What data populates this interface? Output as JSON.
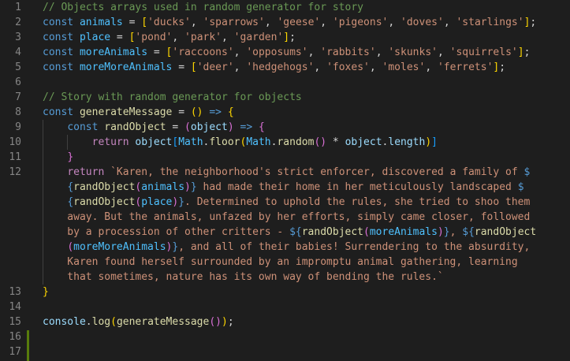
{
  "editor": {
    "line_numbers": [
      "1",
      "2",
      "3",
      "4",
      "5",
      "6",
      "7",
      "8",
      "9",
      "10",
      "11",
      "12",
      "13",
      "14",
      "15",
      "16",
      "17"
    ],
    "lines": [
      [
        {
          "t": "// Objects arrays used in random generator for story",
          "c": "com"
        }
      ],
      [
        {
          "t": "const ",
          "c": "kw"
        },
        {
          "t": "animals",
          "c": "cst"
        },
        {
          "t": " = ",
          "c": "op"
        },
        {
          "t": "[",
          "c": "b1"
        },
        {
          "t": "'ducks'",
          "c": "str"
        },
        {
          "t": ", ",
          "c": "op"
        },
        {
          "t": "'sparrows'",
          "c": "str"
        },
        {
          "t": ", ",
          "c": "op"
        },
        {
          "t": "'geese'",
          "c": "str"
        },
        {
          "t": ", ",
          "c": "op"
        },
        {
          "t": "'pigeons'",
          "c": "str"
        },
        {
          "t": ", ",
          "c": "op"
        },
        {
          "t": "'doves'",
          "c": "str"
        },
        {
          "t": ", ",
          "c": "op"
        },
        {
          "t": "'starlings'",
          "c": "str"
        },
        {
          "t": "]",
          "c": "b1"
        },
        {
          "t": ";",
          "c": "op"
        }
      ],
      [
        {
          "t": "const ",
          "c": "kw"
        },
        {
          "t": "place",
          "c": "cst"
        },
        {
          "t": " = ",
          "c": "op"
        },
        {
          "t": "[",
          "c": "b1"
        },
        {
          "t": "'pond'",
          "c": "str"
        },
        {
          "t": ", ",
          "c": "op"
        },
        {
          "t": "'park'",
          "c": "str"
        },
        {
          "t": ", ",
          "c": "op"
        },
        {
          "t": "'garden'",
          "c": "str"
        },
        {
          "t": "]",
          "c": "b1"
        },
        {
          "t": ";",
          "c": "op"
        }
      ],
      [
        {
          "t": "const ",
          "c": "kw"
        },
        {
          "t": "moreAnimals",
          "c": "cst"
        },
        {
          "t": " = ",
          "c": "op"
        },
        {
          "t": "[",
          "c": "b1"
        },
        {
          "t": "'raccoons'",
          "c": "str"
        },
        {
          "t": ", ",
          "c": "op"
        },
        {
          "t": "'opposums'",
          "c": "str"
        },
        {
          "t": ", ",
          "c": "op"
        },
        {
          "t": "'rabbits'",
          "c": "str"
        },
        {
          "t": ", ",
          "c": "op"
        },
        {
          "t": "'skunks'",
          "c": "str"
        },
        {
          "t": ", ",
          "c": "op"
        },
        {
          "t": "'squirrels'",
          "c": "str"
        },
        {
          "t": "]",
          "c": "b1"
        },
        {
          "t": ";",
          "c": "op"
        }
      ],
      [
        {
          "t": "const ",
          "c": "kw"
        },
        {
          "t": "moreMoreAnimals",
          "c": "cst"
        },
        {
          "t": " = ",
          "c": "op"
        },
        {
          "t": "[",
          "c": "b1"
        },
        {
          "t": "'deer'",
          "c": "str"
        },
        {
          "t": ", ",
          "c": "op"
        },
        {
          "t": "'hedgehogs'",
          "c": "str"
        },
        {
          "t": ", ",
          "c": "op"
        },
        {
          "t": "'foxes'",
          "c": "str"
        },
        {
          "t": ", ",
          "c": "op"
        },
        {
          "t": "'moles'",
          "c": "str"
        },
        {
          "t": ", ",
          "c": "op"
        },
        {
          "t": "'ferrets'",
          "c": "str"
        },
        {
          "t": "]",
          "c": "b1"
        },
        {
          "t": ";",
          "c": "op"
        }
      ],
      [],
      [
        {
          "t": "// Story with random generator for objects",
          "c": "com"
        }
      ],
      [
        {
          "t": "const ",
          "c": "kw"
        },
        {
          "t": "generateMessage",
          "c": "fn"
        },
        {
          "t": " = ",
          "c": "op"
        },
        {
          "t": "()",
          "c": "b1"
        },
        {
          "t": " ",
          "c": "op"
        },
        {
          "t": "=>",
          "c": "kw"
        },
        {
          "t": " ",
          "c": "op"
        },
        {
          "t": "{",
          "c": "b1"
        }
      ],
      [
        {
          "t": "    ",
          "c": "op"
        },
        {
          "t": "const ",
          "c": "kw"
        },
        {
          "t": "randObject",
          "c": "fn"
        },
        {
          "t": " = ",
          "c": "op"
        },
        {
          "t": "(",
          "c": "b2"
        },
        {
          "t": "object",
          "c": "var"
        },
        {
          "t": ")",
          "c": "b2"
        },
        {
          "t": " ",
          "c": "op"
        },
        {
          "t": "=>",
          "c": "kw"
        },
        {
          "t": " ",
          "c": "op"
        },
        {
          "t": "{",
          "c": "b2"
        }
      ],
      [
        {
          "t": "        ",
          "c": "op"
        },
        {
          "t": "return ",
          "c": "ctl"
        },
        {
          "t": "object",
          "c": "var"
        },
        {
          "t": "[",
          "c": "b3"
        },
        {
          "t": "Math",
          "c": "cst"
        },
        {
          "t": ".",
          "c": "op"
        },
        {
          "t": "floor",
          "c": "fn"
        },
        {
          "t": "(",
          "c": "b1"
        },
        {
          "t": "Math",
          "c": "cst"
        },
        {
          "t": ".",
          "c": "op"
        },
        {
          "t": "random",
          "c": "fn"
        },
        {
          "t": "()",
          "c": "b2"
        },
        {
          "t": " * ",
          "c": "op"
        },
        {
          "t": "object",
          "c": "var"
        },
        {
          "t": ".",
          "c": "op"
        },
        {
          "t": "length",
          "c": "var"
        },
        {
          "t": ")",
          "c": "b1"
        },
        {
          "t": "]",
          "c": "b3"
        }
      ],
      [
        {
          "t": "    ",
          "c": "op"
        },
        {
          "t": "}",
          "c": "b2"
        }
      ],
      [
        {
          "t": "    ",
          "c": "op"
        },
        {
          "t": "return ",
          "c": "ctl"
        },
        {
          "t": "`Karen, the neighborhood's strict enforcer, discovered a family of ",
          "c": "str"
        },
        {
          "t": "$",
          "c": "kw"
        }
      ],
      [
        {
          "t": "    ",
          "c": "op"
        },
        {
          "t": "{",
          "c": "kw"
        },
        {
          "t": "randObject",
          "c": "fn"
        },
        {
          "t": "(",
          "c": "b2"
        },
        {
          "t": "animals",
          "c": "cst"
        },
        {
          "t": ")",
          "c": "b2"
        },
        {
          "t": "}",
          "c": "kw"
        },
        {
          "t": " had made their home in her meticulously landscaped ",
          "c": "str"
        },
        {
          "t": "$",
          "c": "kw"
        }
      ],
      [
        {
          "t": "    ",
          "c": "op"
        },
        {
          "t": "{",
          "c": "kw"
        },
        {
          "t": "randObject",
          "c": "fn"
        },
        {
          "t": "(",
          "c": "b2"
        },
        {
          "t": "place",
          "c": "cst"
        },
        {
          "t": ")",
          "c": "b2"
        },
        {
          "t": "}",
          "c": "kw"
        },
        {
          "t": ". Determined to uphold the rules, she tried to shoo them",
          "c": "str"
        }
      ],
      [
        {
          "t": "    away. But the animals, unfazed by her efforts, simply came closer, followed",
          "c": "str"
        }
      ],
      [
        {
          "t": "    by a procession of other critters - ",
          "c": "str"
        },
        {
          "t": "${",
          "c": "kw"
        },
        {
          "t": "randObject",
          "c": "fn"
        },
        {
          "t": "(",
          "c": "b2"
        },
        {
          "t": "moreAnimals",
          "c": "cst"
        },
        {
          "t": ")",
          "c": "b2"
        },
        {
          "t": "}",
          "c": "kw"
        },
        {
          "t": ", ",
          "c": "str"
        },
        {
          "t": "${",
          "c": "kw"
        },
        {
          "t": "randObject",
          "c": "fn"
        }
      ],
      [
        {
          "t": "    ",
          "c": "op"
        },
        {
          "t": "(",
          "c": "b2"
        },
        {
          "t": "moreMoreAnimals",
          "c": "cst"
        },
        {
          "t": ")",
          "c": "b2"
        },
        {
          "t": "}",
          "c": "kw"
        },
        {
          "t": ", and all of their babies! Surrendering to the absurdity,",
          "c": "str"
        }
      ],
      [
        {
          "t": "    Karen found herself surrounded by an impromptu animal gathering, learning",
          "c": "str"
        }
      ],
      [
        {
          "t": "    that sometimes, nature has its own way of bending the rules.`",
          "c": "str"
        }
      ],
      [
        {
          "t": "}",
          "c": "b1"
        }
      ],
      [],
      [
        {
          "t": "console",
          "c": "var"
        },
        {
          "t": ".",
          "c": "op"
        },
        {
          "t": "log",
          "c": "fn"
        },
        {
          "t": "(",
          "c": "b1"
        },
        {
          "t": "generateMessage",
          "c": "fn"
        },
        {
          "t": "()",
          "c": "b2"
        },
        {
          "t": ")",
          "c": "b1"
        },
        {
          "t": ";",
          "c": "op"
        }
      ],
      [],
      []
    ],
    "line_number_rows": [
      0,
      1,
      2,
      3,
      4,
      5,
      6,
      7,
      8,
      9,
      10,
      11,
      null,
      null,
      null,
      null,
      null,
      null,
      null,
      12,
      13,
      14,
      15,
      16
    ],
    "colors": {
      "background": "#1e1e1e",
      "line_number": "#858585",
      "keyword": "#569cd6",
      "control": "#c586c0",
      "variable": "#9cdcfe",
      "constant": "#4fc1ff",
      "function": "#dcdcaa",
      "string": "#ce9178",
      "comment": "#6a9955",
      "modified_gutter": "#587c0c"
    }
  }
}
